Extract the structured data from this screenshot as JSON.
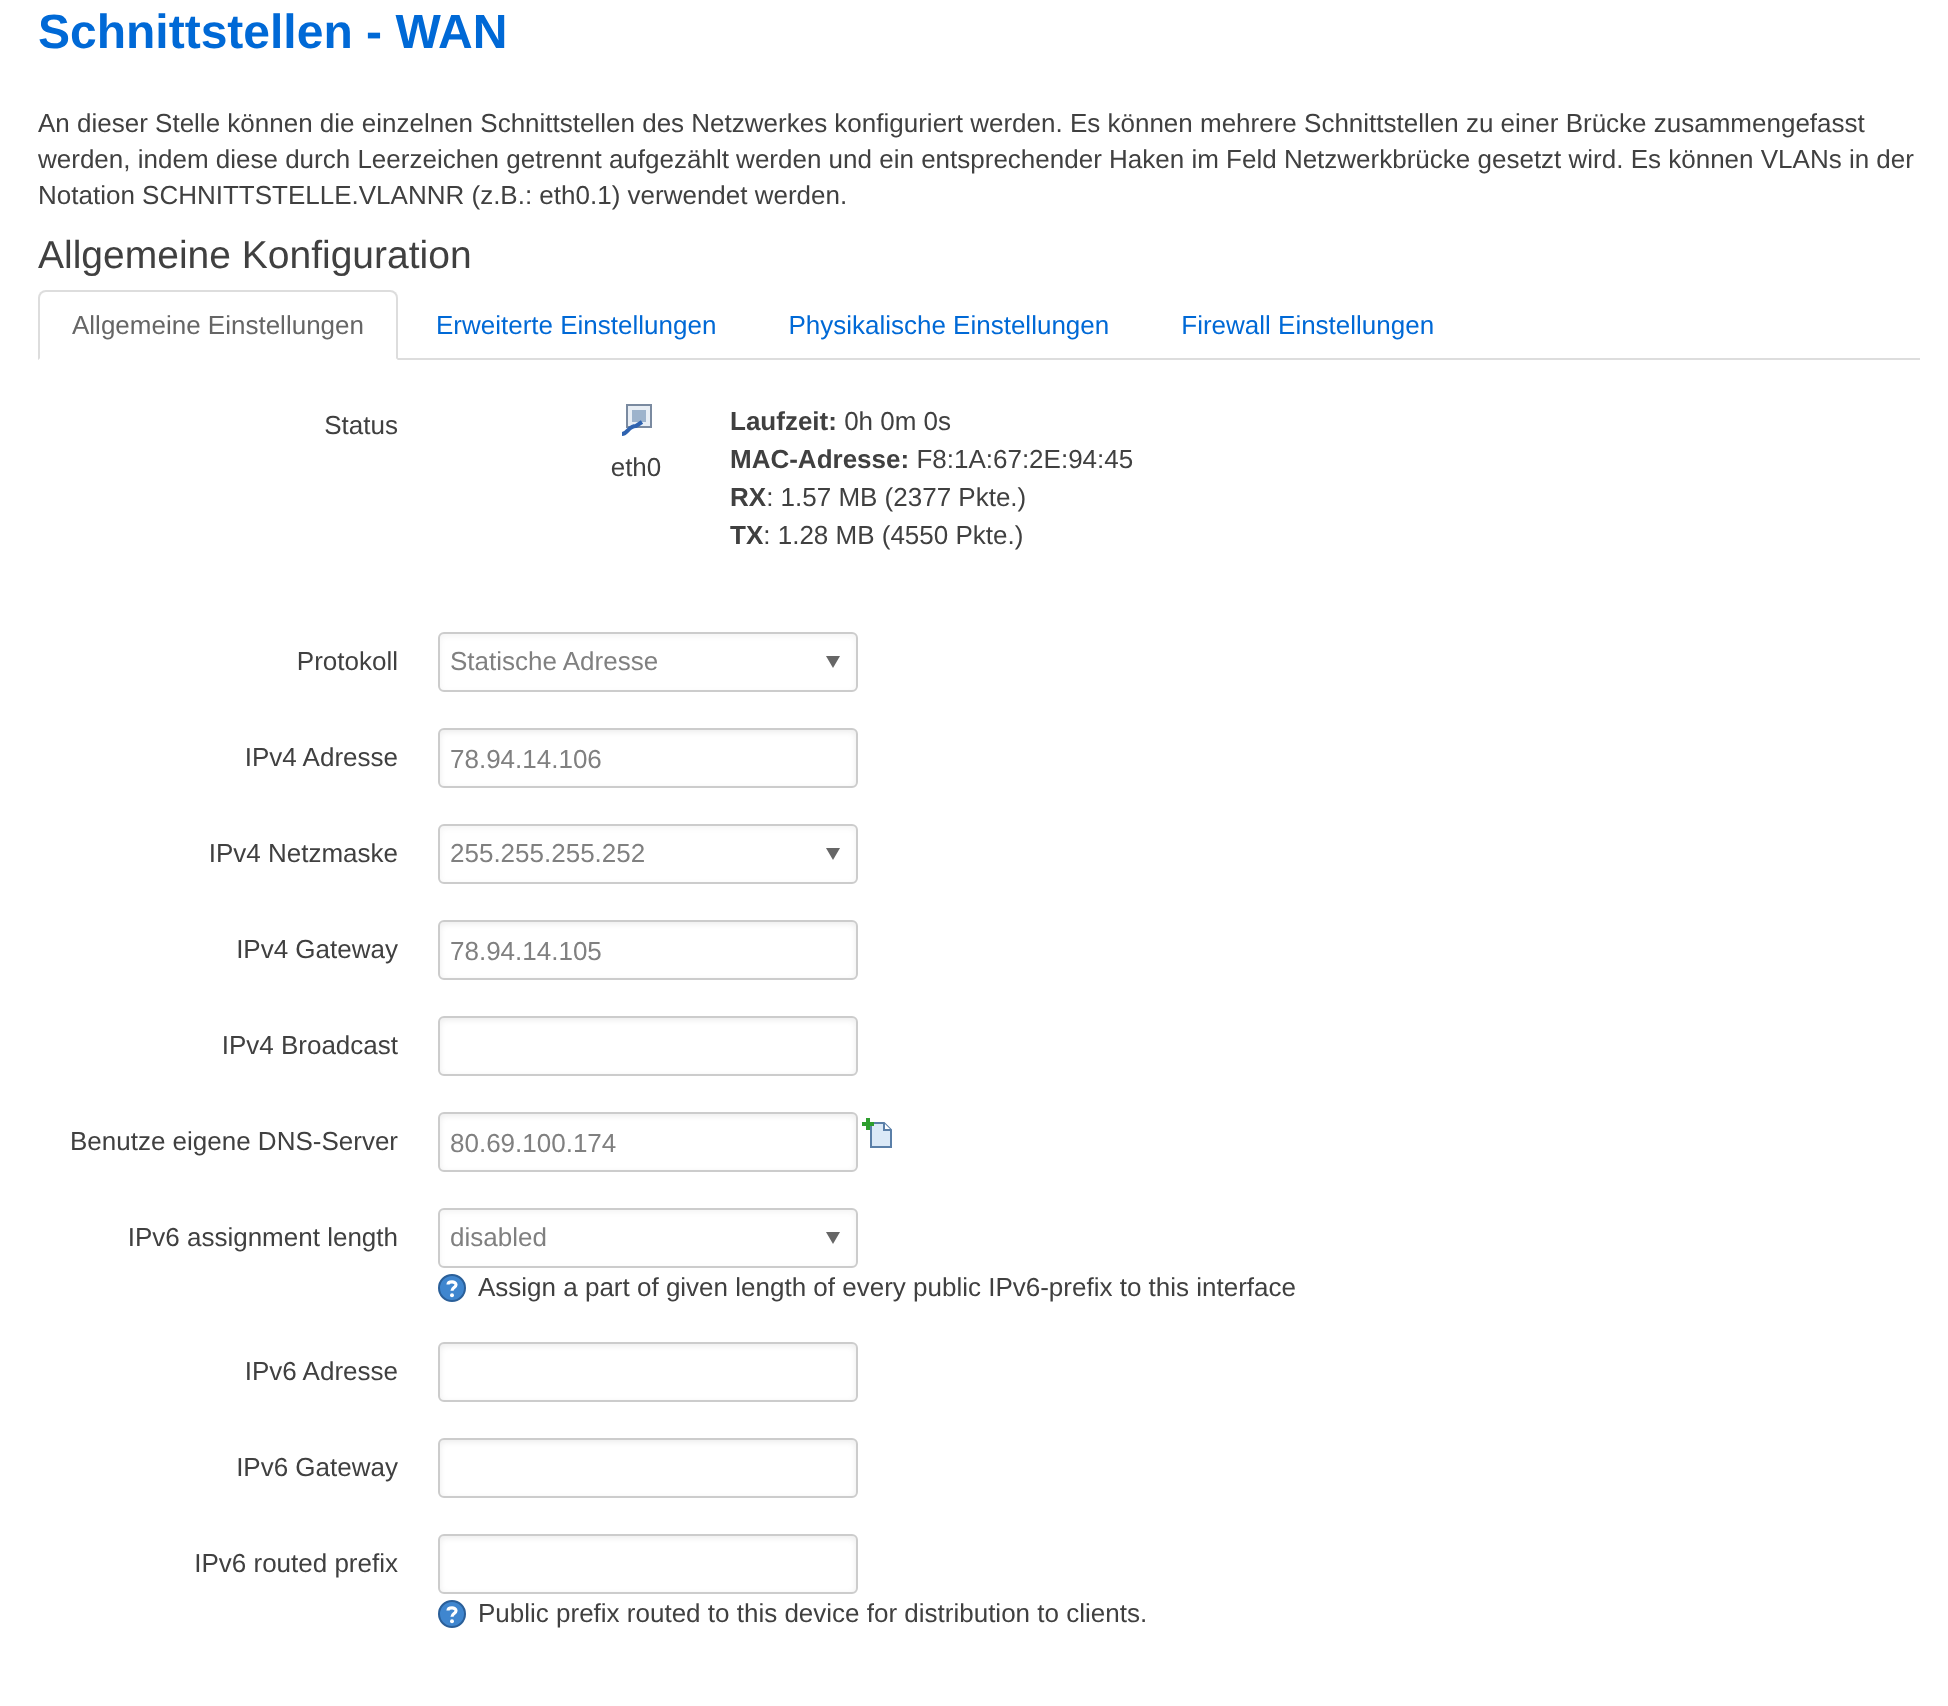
{
  "page": {
    "title": "Schnittstellen - WAN",
    "description": "An dieser Stelle können die einzelnen Schnittstellen des Netzwerkes konfiguriert werden. Es können mehrere Schnittstellen zu einer Brücke zusammengefasst werden, indem diese durch Leerzeichen getrennt aufgezählt werden und ein entsprechender Haken im Feld Netzwerkbrücke gesetzt wird. Es können VLANs in der Notation SCHNITTSTELLE.VLANNR (z.B.: eth0.1) verwendet werden."
  },
  "section": {
    "title": "Allgemeine Konfiguration"
  },
  "tabs": [
    {
      "label": "Allgemeine Einstellungen",
      "selected": true
    },
    {
      "label": "Erweiterte Einstellungen",
      "selected": false
    },
    {
      "label": "Physikalische Einstellungen",
      "selected": false
    },
    {
      "label": "Firewall Einstellungen",
      "selected": false
    }
  ],
  "status": {
    "label": "Status",
    "device": "eth0",
    "lines": [
      "**Laufzeit:** 0h 0m 0s",
      "**MAC-Adresse:** F8:1A:67:2E:94:45",
      "**RX**: 1.57 MB (2377 Pkte.)",
      "**TX**: 1.28 MB (4550 Pkte.)"
    ]
  },
  "fields": [
    {
      "label": "Protokoll",
      "kind": "select",
      "value": "Statische Adresse"
    },
    {
      "label": "IPv4 Adresse",
      "kind": "text",
      "value": "78.94.14.106"
    },
    {
      "label": "IPv4 Netzmaske",
      "kind": "select",
      "value": "255.255.255.252"
    },
    {
      "label": "IPv4 Gateway",
      "kind": "text",
      "value": "78.94.14.105"
    },
    {
      "label": "IPv4 Broadcast",
      "kind": "text"
    },
    {
      "label": "Benutze eigene DNS-Server",
      "kind": "text",
      "value": "80.69.100.174",
      "add_button": true
    },
    {
      "label": "IPv6 assignment length",
      "kind": "select",
      "value": "disabled",
      "help": "Assign a part of given length of every public IPv6-prefix to this interface"
    },
    {
      "label": "IPv6 Adresse",
      "kind": "text"
    },
    {
      "label": "IPv6 Gateway",
      "kind": "text"
    },
    {
      "label": "IPv6 routed prefix",
      "kind": "text",
      "help": "Public prefix routed to this device for distribution to clients."
    }
  ]
}
